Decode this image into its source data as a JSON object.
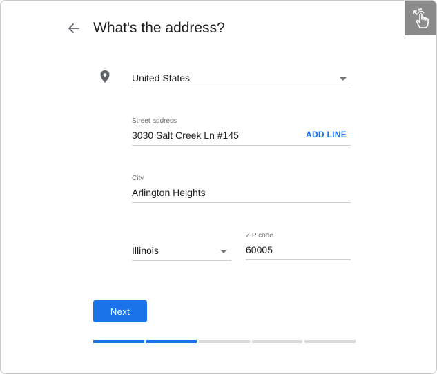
{
  "header": {
    "title": "What's the address?"
  },
  "colors": {
    "accent": "#1a73e8",
    "progress_inactive": "#dadada",
    "badge_bg": "#8a8a8a"
  },
  "icons": {
    "back": "arrow-left-icon",
    "location": "place-icon",
    "touch": "touch-gesture-icon"
  },
  "form": {
    "country": {
      "value": "United States"
    },
    "street": {
      "label": "Street address",
      "value": "3030 Salt Creek Ln #145",
      "add_line_label": "ADD LINE"
    },
    "city": {
      "label": "City",
      "value": "Arlington Heights"
    },
    "state": {
      "value": "Illinois"
    },
    "zip": {
      "label": "ZIP code",
      "value": "60005"
    }
  },
  "actions": {
    "next_label": "Next"
  },
  "progress": {
    "total_steps": 5,
    "completed_steps": 2
  }
}
